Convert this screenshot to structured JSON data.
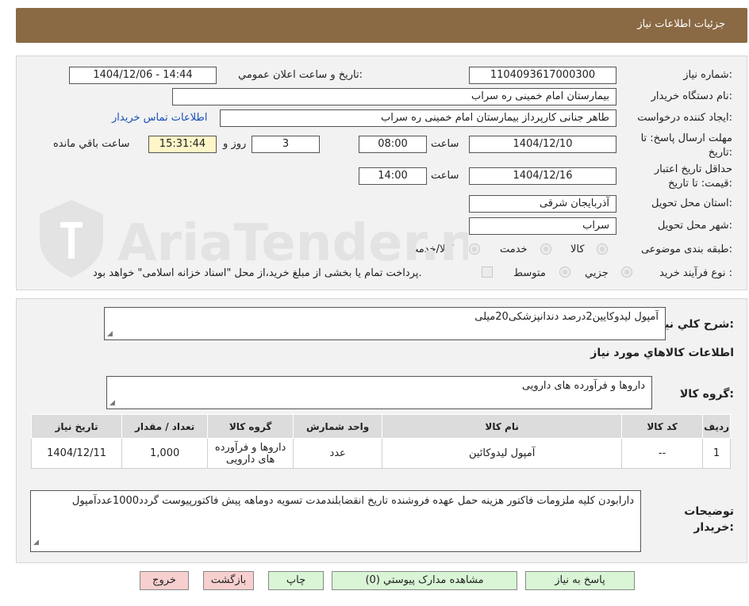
{
  "header": {
    "title": "جزئیات اطلاعات نیاز"
  },
  "form": {
    "need_number_label": "شماره نیاز:",
    "need_number": "1104093617000300",
    "announce_label": "تاریخ و ساعت اعلان عمومي:",
    "announce_value": "1404/12/06 - 14:44",
    "buyer_label": "نام دستگاه خریدار:",
    "buyer_value": "بیمارستان امام خمینی ره  سراب",
    "creator_label": "ایجاد کننده درخواست:",
    "creator_value": "طاهر جنانی کارپرداز بیمارستان امام خمینی ره  سراب",
    "contact_link": "اطلاعات تماس خریدار",
    "deadline_label_1": "مهلت ارسال پاسخ: تا",
    "deadline_label_2": "تاریخ:",
    "deadline_date": "1404/12/10",
    "time_label": "ساعت",
    "deadline_time": "08:00",
    "days_value": "3",
    "days_label": "روز و",
    "remaining_time": "15:31:44",
    "remaining_label": "ساعت باقي مانده",
    "validity_label_1": "حداقل تاریخ اعتبار",
    "validity_label_2": "قیمت: تا تاریخ:",
    "validity_date": "1404/12/16",
    "validity_time": "14:00",
    "province_label": "استان محل تحویل:",
    "province_value": "آذربایجان شرقی",
    "city_label": "شهر محل تحویل:",
    "city_value": "سراب",
    "category_label": "طبقه بندی موضوعی:",
    "category_options": [
      "کالا",
      "خدمت",
      "کالا/خدمت"
    ],
    "process_label": "نوع فرآیند خرید :",
    "process_options": [
      "جزیي",
      "متوسط"
    ],
    "process_note": "پرداخت تمام یا بخشی از مبلغ خرید،از محل \"اسناد خزانه اسلامی\" خواهد بود."
  },
  "details": {
    "summary_label": "شرح کلي نیاز:",
    "summary_value": "آمپول لیدوکایین2درصد دندانپزشکی20میلی",
    "goods_info_title": "اطلاعات کالاهاي مورد نیاز",
    "goods_group_label": "گروه کالا:",
    "goods_group_value": "داروها و فرآورده های دارویی",
    "table": {
      "headers": [
        "ردیف",
        "کد کالا",
        "نام کالا",
        "واحد شمارش",
        "گروه کالا",
        "تعداد / مقدار",
        "تاریخ نیاز"
      ],
      "rows": [
        [
          "1",
          "--",
          "آمپول لیدوکائین",
          "عدد",
          "داروها و فرآورده های دارویی",
          "1,000",
          "1404/12/11"
        ]
      ]
    },
    "buyer_notes_label": "توضیحات خریدار:",
    "buyer_notes_value": "دارابودن کلیه ملزومات فاکتور هزینه حمل عهده فروشنده تاریخ انقضابلندمدت تسویه دوماهه پیش فاکتورپیوست گردد1000عددآمپول"
  },
  "buttons": {
    "reply": "پاسخ به نیاز",
    "attachments": "مشاهده مدارک پیوستي (0)",
    "print": "چاپ",
    "back": "بازگشت",
    "exit": "خروج"
  },
  "watermark": {
    "text": "AriaTender.neT"
  },
  "colors": {
    "header_bg": "#8a6a44",
    "button_green": "#d9f5d6",
    "button_pink": "#f7cfcf",
    "link": "#1a4fb8"
  }
}
